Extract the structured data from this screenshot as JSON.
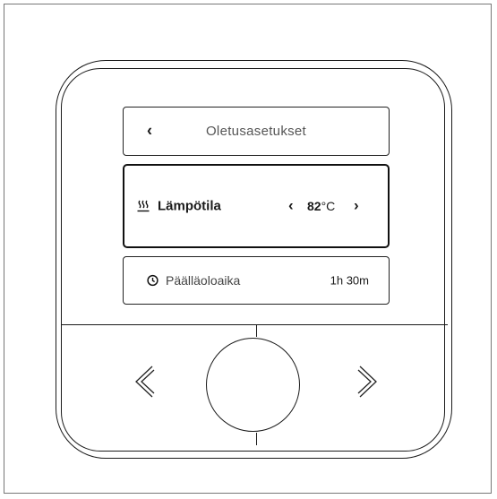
{
  "screen": {
    "header": {
      "back_icon": "chevron-left-icon",
      "title": "Oletusasetukset"
    },
    "selected_setting": {
      "icon": "heating-icon",
      "label": "Lämpötila",
      "value": "82",
      "unit": "°C",
      "decrease_icon": "chevron-left-icon",
      "increase_icon": "chevron-right-icon"
    },
    "duration_setting": {
      "icon": "clock-icon",
      "label": "Päälläoloaika",
      "value": "1h 30m"
    }
  },
  "controls": {
    "left_button_icon": "arrow-left-icon",
    "right_button_icon": "arrow-right-icon",
    "knob": "rotary-knob"
  }
}
